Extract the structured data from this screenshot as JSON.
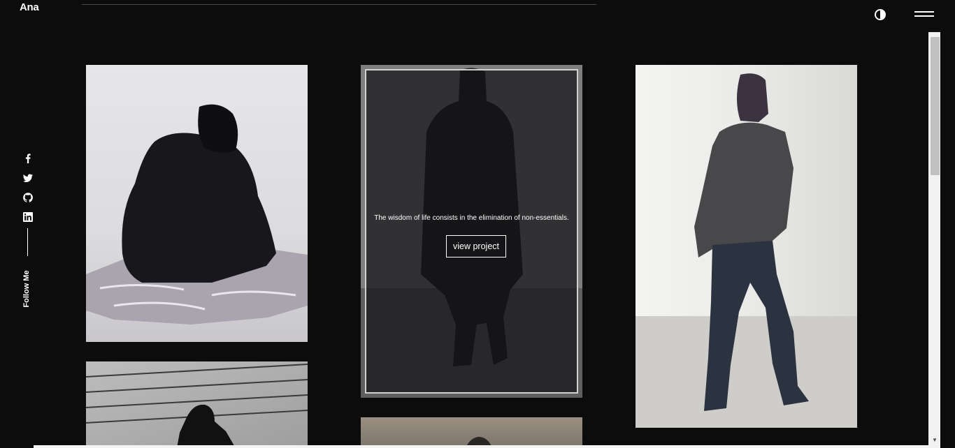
{
  "header": {
    "logo": "Ana",
    "theme_toggle_icon": "contrast-icon",
    "menu_icon": "hamburger-menu-icon"
  },
  "social": {
    "items": [
      {
        "icon": "facebook-icon"
      },
      {
        "icon": "twitter-icon"
      },
      {
        "icon": "github-icon"
      },
      {
        "icon": "linkedin-icon"
      }
    ],
    "label": "Follow Me"
  },
  "gallery": {
    "featured": {
      "quote": "The wisdom of life consists in the elimination of non-essentials.",
      "button_label": "view project"
    }
  },
  "colors": {
    "background": "#0c0c0c",
    "text": "#ffffff",
    "overlay_border": "#d0d0d0"
  }
}
